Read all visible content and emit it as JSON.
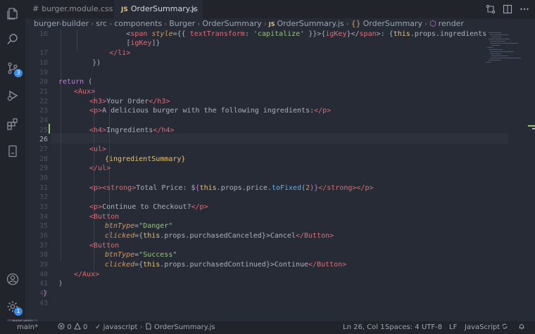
{
  "tabs": [
    {
      "lang": "#",
      "label": "burger.module.css",
      "active": false
    },
    {
      "lang": "JS",
      "label": "OrderSummary.js",
      "active": true,
      "close": "×"
    }
  ],
  "breadcrumb": {
    "parts": [
      "burger-builder",
      "src",
      "components",
      "Burger",
      "OrderSummary"
    ],
    "file_lang": "JS",
    "file": "OrderSummary.js",
    "symbol_icon": "{}",
    "symbol": "OrderSummary",
    "method_icon": "⬡",
    "method": "render",
    "separator": "›"
  },
  "activity": {
    "scm_badge": "3",
    "settings_badge": "1"
  },
  "editor": {
    "line_numbers": [
      "16",
      "",
      "17",
      "18",
      "19",
      "20",
      "21",
      "22",
      "23",
      "24",
      "25",
      "26",
      "27",
      "28",
      "29",
      "30",
      "31",
      "32",
      "33",
      "34",
      "35",
      "36",
      "37",
      "38",
      "39",
      "40",
      "41",
      "42",
      "43"
    ],
    "current_line": "26"
  },
  "code": {
    "l16a_indent": "                ",
    "l16a_open": "<",
    "l16a_tag": "span",
    "l16a_attr": " style",
    "l16a_eq": "={{ ",
    "l16a_key": "textTransform",
    "l16a_colon": ": ",
    "l16a_str": "'capitalize'",
    "l16a_close": " }}>{",
    "l16a_var": "igKey",
    "l16a_end": "}</",
    "l16a_tag2": "span",
    "l16a_gt": ">: {",
    "l16a_this": "this",
    "l16a_props": ".props.ingredients",
    "l16b_indent": "                [",
    "l16b_var": "igKey",
    "l16b_end": "]}",
    "l17": "            </li>",
    "l18": "        })",
    "l20_kw": "return",
    "l20_paren": " (",
    "l21_tag": "<Aux>",
    "l22_open": "<h3>",
    "l22_text": "Your Order",
    "l22_close": "</h3>",
    "l23_open": "<p>",
    "l23_text": "A delicious burger with the following ingredients:",
    "l23_close": "</p>",
    "l25_open": "<h4>",
    "l25_text": "Ingredients",
    "l25_close": "</h4>",
    "l27_open": "<ul>",
    "l28_text": "{ingredientSummary}",
    "l29_close": "</ul>",
    "l31_p": "<p>",
    "l31_strong": "<strong>",
    "l31_text": "Total Price: ",
    "l31_dollar": "$",
    "l31_brace": "{",
    "l31_this": "this",
    "l31_props": ".props.price.",
    "l31_fn": "toFixed",
    "l31_arg_open": "(",
    "l31_num": "2",
    "l31_arg_close": ")}",
    "l31_strong_close": "</strong>",
    "l31_p_close": "</p>",
    "l33_open": "<p>",
    "l33_text": "Continue to Checkout?",
    "l33_close": "</p>",
    "l34_tag": "<Button",
    "l35_attr": "btnType",
    "l35_eq": "=",
    "l35_str": "\"Danger\"",
    "l36_attr": "clicked",
    "l36_eq": "={",
    "l36_this": "this",
    "l36_props": ".props.purchasedCanceled",
    "l36_end": "}>",
    "l36_text": "Cancel",
    "l36_close": "</Button>",
    "l37_tag": "<Button",
    "l38_attr": "btnType",
    "l38_eq": "=",
    "l38_str": "\"Success\"",
    "l39_attr": "clicked",
    "l39_eq": "={",
    "l39_this": "this",
    "l39_props": ".props.purchasedContinued",
    "l39_end": "}>",
    "l39_text": "Continue",
    "l39_close": "</Button>",
    "l40_tag": "</Aux>",
    "l41_paren": ")",
    "l42_brace": "}"
  },
  "status": {
    "branch": "main*",
    "errors": "0",
    "warnings": "0",
    "language_crumb": "javascript",
    "file_crumb": "OrderSummary.js",
    "position": "Ln 26, Col 1",
    "spaces": "Spaces: 4",
    "encoding": "UTF-8",
    "eol": "LF",
    "language": "JavaScript",
    "made_with": "MADE WITH GIFOX"
  },
  "colors": {
    "background": "#262b35",
    "keyword": "#c678dd",
    "tag": "#e06c75",
    "string": "#98c379",
    "attribute": "#d19a66",
    "function": "#61afef",
    "this": "#e5c07b",
    "badge": "#3c8ce7"
  }
}
